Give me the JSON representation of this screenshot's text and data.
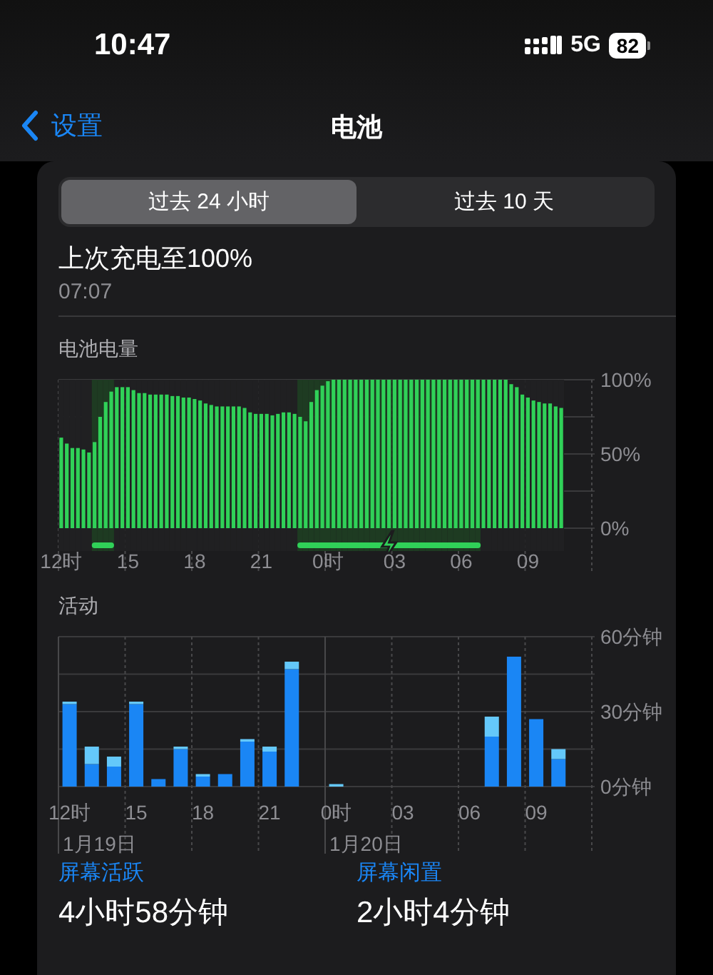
{
  "status_bar": {
    "time": "10:47",
    "network": "5G",
    "battery": "82"
  },
  "nav": {
    "back": "设置",
    "title": "电池"
  },
  "segments": [
    {
      "label": "过去 24 小时",
      "selected": true
    },
    {
      "label": "过去 10 天",
      "selected": false
    }
  ],
  "last_charge": {
    "label": "上次充电至100%",
    "time": "07:07"
  },
  "battery_chart": {
    "chart_data": {
      "type": "bar",
      "title": "电池电量",
      "grid": true,
      "ylim": [
        0,
        100
      ],
      "yticks": [
        {
          "value": 100,
          "label": "100%"
        },
        {
          "value": 50,
          "label": "50%"
        },
        {
          "value": 0,
          "label": "0%"
        }
      ],
      "categories": [
        "12时",
        null,
        null,
        null,
        null,
        null,
        null,
        null,
        null,
        null,
        null,
        null,
        "15",
        null,
        null,
        null,
        null,
        null,
        null,
        null,
        null,
        null,
        null,
        null,
        "18",
        null,
        null,
        null,
        null,
        null,
        null,
        null,
        null,
        null,
        null,
        null,
        "21",
        null,
        null,
        null,
        null,
        null,
        null,
        null,
        null,
        null,
        null,
        null,
        "0时",
        null,
        null,
        null,
        null,
        null,
        null,
        null,
        null,
        null,
        null,
        null,
        "03",
        null,
        null,
        null,
        null,
        null,
        null,
        null,
        null,
        null,
        null,
        null,
        "06",
        null,
        null,
        null,
        null,
        null,
        null,
        null,
        null,
        null,
        null,
        null,
        "09",
        null,
        null,
        null,
        null,
        null,
        null,
        null,
        null,
        null,
        null,
        null
      ],
      "series": [
        {
          "color": "#30d158",
          "values": [
            61,
            57,
            54,
            54,
            53,
            51,
            58,
            75,
            85,
            92,
            95,
            95,
            95,
            93,
            91,
            91,
            90,
            90,
            90,
            90,
            89,
            89,
            88,
            88,
            87,
            86,
            84,
            83,
            82,
            82,
            82,
            82,
            82,
            81,
            78,
            77,
            77,
            77,
            76,
            77,
            78,
            78,
            77,
            75,
            72,
            85,
            93,
            96,
            99,
            100,
            100,
            100,
            100,
            100,
            100,
            100,
            100,
            100,
            100,
            100,
            100,
            100,
            100,
            100,
            100,
            100,
            100,
            100,
            100,
            100,
            100,
            100,
            100,
            100,
            100,
            100,
            100,
            100,
            100,
            100,
            100,
            97,
            95,
            90,
            88,
            86,
            85,
            84,
            84,
            82,
            81,
            null,
            null,
            null,
            null,
            null
          ]
        }
      ]
    },
    "charging": [
      false,
      false,
      false,
      false,
      false,
      false,
      true,
      true,
      true,
      true,
      false,
      false,
      false,
      false,
      false,
      false,
      false,
      false,
      false,
      false,
      false,
      false,
      false,
      false,
      false,
      false,
      false,
      false,
      false,
      false,
      false,
      false,
      false,
      false,
      false,
      false,
      false,
      false,
      false,
      false,
      false,
      false,
      false,
      true,
      true,
      true,
      true,
      true,
      true,
      true,
      true,
      true,
      true,
      true,
      true,
      true,
      true,
      true,
      true,
      true,
      true,
      true,
      true,
      true,
      true,
      true,
      true,
      true,
      true,
      true,
      true,
      true,
      true,
      true,
      true,
      true,
      false,
      false,
      false,
      false,
      false,
      false,
      false,
      false,
      false,
      false,
      false,
      false,
      false,
      false,
      false
    ]
  },
  "activity_chart": {
    "chart_data": {
      "type": "bar",
      "title": "活动",
      "stacked": true,
      "grid": true,
      "ylim": [
        0,
        60
      ],
      "yticks": [
        {
          "value": 60,
          "label": "60分钟"
        },
        {
          "value": 30,
          "label": "30分钟"
        },
        {
          "value": 0,
          "label": "0分钟"
        }
      ],
      "categories": [
        "12时",
        null,
        null,
        "15",
        null,
        null,
        "18",
        null,
        null,
        "21",
        null,
        null,
        "0时",
        null,
        null,
        "03",
        null,
        null,
        "06",
        null,
        null,
        "09",
        null,
        null
      ],
      "series": [
        {
          "color": "#1a86f5",
          "values": [
            33,
            9,
            8,
            33,
            3,
            15,
            4,
            5,
            18,
            14,
            47,
            0,
            0,
            0,
            0,
            0,
            0,
            0,
            0,
            20,
            52,
            27,
            11,
            null
          ]
        },
        {
          "color": "#64c8fa",
          "values": [
            1,
            7,
            4,
            1,
            0,
            1,
            1,
            0,
            1,
            2,
            3,
            0,
            1,
            0,
            0,
            0,
            0,
            0,
            0,
            8,
            0,
            0,
            4,
            null
          ]
        }
      ]
    },
    "date_labels": [
      "1月19日",
      "1月20日"
    ]
  },
  "summary": [
    {
      "label": "屏幕活跃",
      "value": "4小时58分钟"
    },
    {
      "label": "屏幕闲置",
      "value": "2小时4分钟"
    }
  ]
}
